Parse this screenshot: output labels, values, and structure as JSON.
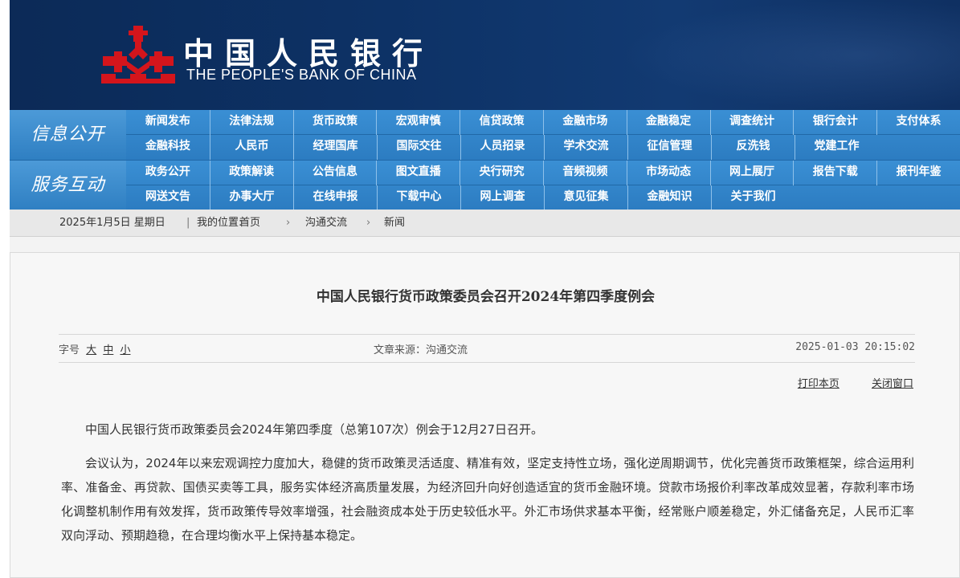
{
  "header": {
    "logo_cn": "中国人民银行",
    "logo_en": "THE PEOPLE'S BANK OF CHINA",
    "colors": {
      "banner": "#0d3266",
      "logo_red": "#d4151c",
      "nav": "#2e7fc5"
    }
  },
  "nav": {
    "info": {
      "label": "信息公开",
      "row1": [
        "新闻发布",
        "法律法规",
        "货币政策",
        "宏观审慎",
        "信贷政策",
        "金融市场",
        "金融稳定",
        "调查统计",
        "银行会计",
        "支付体系"
      ],
      "row2": [
        "金融科技",
        "人民币",
        "经理国库",
        "国际交往",
        "人员招录",
        "学术交流",
        "征信管理",
        "反洗钱",
        "党建工作"
      ]
    },
    "service": {
      "label": "服务互动",
      "row1": [
        "政务公开",
        "政策解读",
        "公告信息",
        "图文直播",
        "央行研究",
        "音频视频",
        "市场动态",
        "网上展厅",
        "报告下载",
        "报刊年鉴"
      ],
      "row2": [
        "网送文告",
        "办事大厅",
        "在线申报",
        "下载中心",
        "网上调查",
        "意见征集",
        "金融知识",
        "关于我们"
      ]
    }
  },
  "breadcrumb": {
    "date": "2025年1月5日  星期日",
    "location_label": "我的位置:",
    "home": "首页",
    "level1": "沟通交流",
    "level2": "新闻",
    "separator": "|",
    "arrow": "›"
  },
  "article": {
    "title": "中国人民银行货币政策委员会召开2024年第四季度例会",
    "font_size_label": "字号",
    "font_sizes": [
      "大",
      "中",
      "小"
    ],
    "source": "文章来源：沟通交流",
    "time": "2025-01-03 20:15:02",
    "print_label": "打印本页",
    "close_label": "关闭窗口",
    "paragraphs": [
      "中国人民银行货币政策委员会2024年第四季度（总第107次）例会于12月27日召开。",
      "会议认为，2024年以来宏观调控力度加大，稳健的货币政策灵活适度、精准有效，坚定支持性立场，强化逆周期调节，优化完善货币政策框架，综合运用利率、准备金、再贷款、国债买卖等工具，服务实体经济高质量发展，为经济回升向好创造适宜的货币金融环境。贷款市场报价利率改革成效显著，存款利率市场化调整机制作用有效发挥，货币政策传导效率增强，社会融资成本处于历史较低水平。外汇市场供求基本平衡，经常账户顺差稳定，外汇储备充足，人民币汇率双向浮动、预期趋稳，在合理均衡水平上保持基本稳定。"
    ]
  }
}
